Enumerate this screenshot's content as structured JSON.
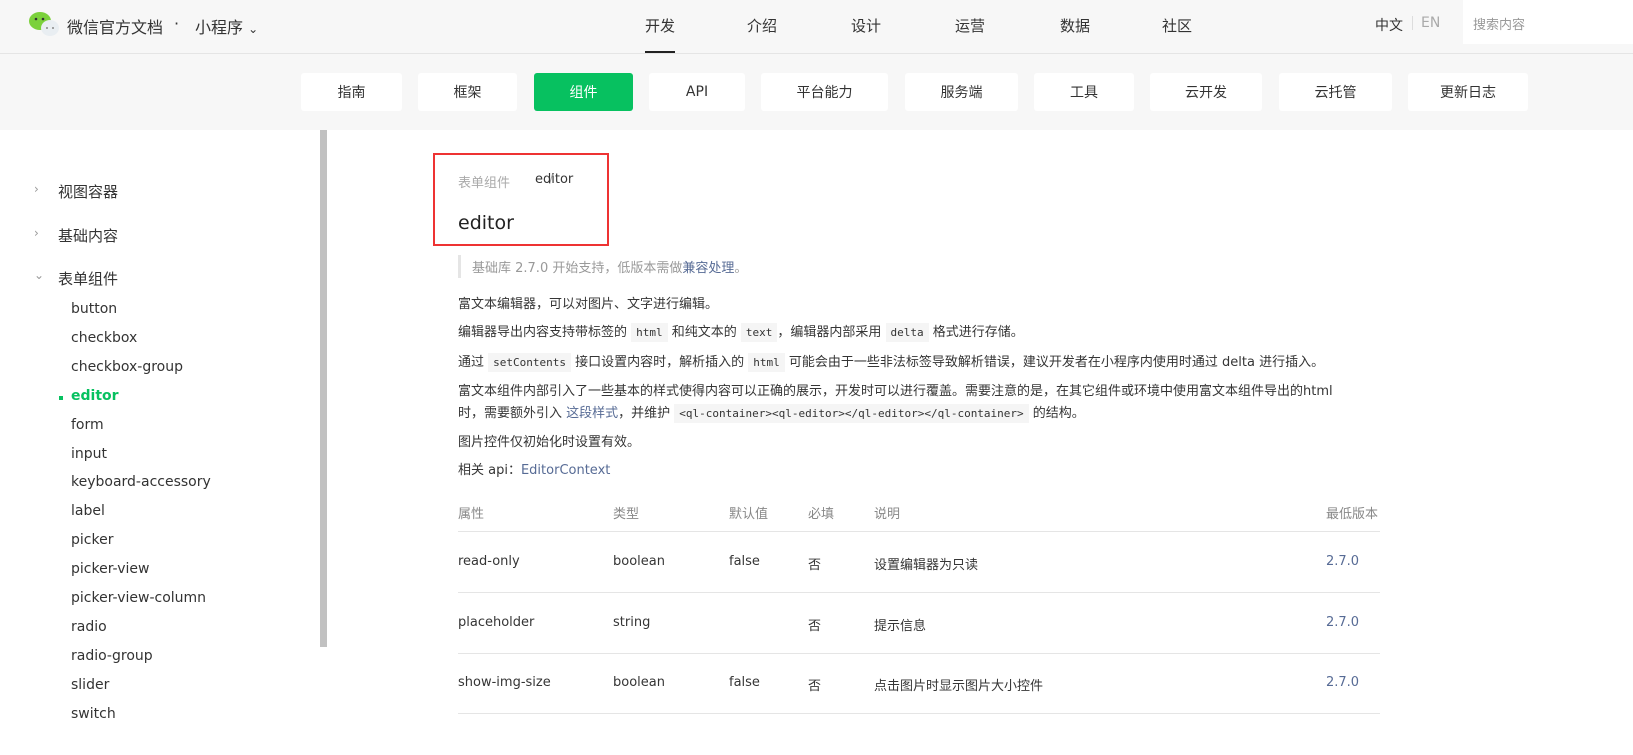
{
  "header": {
    "brand": "微信官方文档",
    "separator": "·",
    "product": "小程序",
    "nav": [
      "开发",
      "介绍",
      "设计",
      "运营",
      "数据",
      "社区"
    ],
    "active_nav": "开发",
    "lang_zh": "中文",
    "lang_en": "EN",
    "search_placeholder": "搜索内容"
  },
  "subnav": [
    "指南",
    "框架",
    "组件",
    "API",
    "平台能力",
    "服务端",
    "工具",
    "云开发",
    "云托管",
    "更新日志"
  ],
  "sidebar": {
    "groups": [
      "视图容器",
      "基础内容",
      "表单组件"
    ],
    "items": [
      "button",
      "checkbox",
      "checkbox-group",
      "editor",
      "form",
      "input",
      "keyboard-accessory",
      "label",
      "picker",
      "picker-view",
      "picker-view-column",
      "radio",
      "radio-group",
      "slider",
      "switch"
    ],
    "active": "editor"
  },
  "content": {
    "breadcrumb_parent": "表单组件",
    "breadcrumb_sep": "/",
    "breadcrumb_current": "editor",
    "title": "editor",
    "note_prefix": "基础库 2.7.0 开始支持，低版本需做",
    "note_link": "兼容处理",
    "note_suffix": "。",
    "p1": "富文本编辑器，可以对图片、文字进行编辑。",
    "p2": [
      "编辑器导出内容支持带标签的 ",
      "html",
      " 和纯文本的 ",
      "text",
      "，编辑器内部采用 ",
      "delta",
      " 格式进行存储。"
    ],
    "p3": [
      "通过 ",
      "setContents",
      " 接口设置内容时，解析插入的 ",
      "html",
      " 可能会由于一些非法标签导致解析错误，建议开发者在小程序内使用时通过 delta 进行插入。"
    ],
    "p4a": "富文本组件内部引入了一些基本的样式使得内容可以正确的展示，开发时可以进行覆盖。需要注意的是，在其它组件或环境中使用富文本组件导出的html",
    "p4b": [
      "时，需要额外引入 ",
      "这段样式",
      "，并维护 ",
      "<ql-container><ql-editor></ql-editor></ql-container>",
      " 的结构。"
    ],
    "p5": "图片控件仅初始化时设置有效。",
    "p6_label": "相关 api：",
    "p6_link": "EditorContext"
  },
  "table": {
    "headers": [
      "属性",
      "类型",
      "默认值",
      "必填",
      "说明",
      "最低版本"
    ],
    "rows": [
      [
        "read-only",
        "boolean",
        "false",
        "否",
        "设置编辑器为只读",
        "2.7.0"
      ],
      [
        "placeholder",
        "string",
        "",
        "否",
        "提示信息",
        "2.7.0"
      ],
      [
        "show-img-size",
        "boolean",
        "false",
        "否",
        "点击图片时显示图片大小控件",
        "2.7.0"
      ]
    ]
  },
  "colors": {
    "accent": "#07c160",
    "link": "#576b95",
    "highlight_box": "#ee3333"
  }
}
